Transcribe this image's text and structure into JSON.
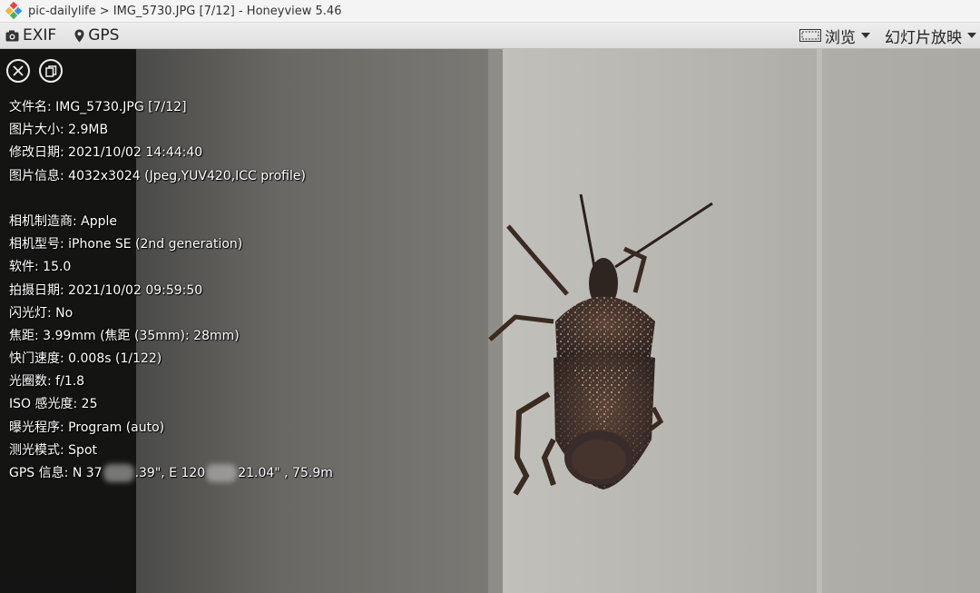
{
  "window": {
    "title": "pic-dailylife > IMG_5730.JPG [7/12] - Honeyview 5.46",
    "icon": "honeyview-logo-icon"
  },
  "toolbar": {
    "exif_label": "EXIF",
    "gps_label": "GPS",
    "browse_label": "浏览",
    "slideshow_label": "幻灯片放映"
  },
  "panel": {
    "close_icon": "close-icon",
    "copy_icon": "copy-icon",
    "file_info": [
      {
        "label": "文件名",
        "value": "IMG_5730.JPG [7/12]"
      },
      {
        "label": "图片大小",
        "value": "2.9MB"
      },
      {
        "label": "修改日期",
        "value": "2021/10/02 14:44:40"
      },
      {
        "label": "图片信息",
        "value": "4032x3024 (Jpeg,YUV420,ICC profile)"
      }
    ],
    "camera_info": [
      {
        "label": "相机制造商",
        "value": "Apple"
      },
      {
        "label": "相机型号",
        "value": "iPhone SE (2nd generation)"
      },
      {
        "label": "软件",
        "value": "15.0"
      },
      {
        "label": "拍摄日期",
        "value": "2021/10/02 09:59:50"
      },
      {
        "label": "闪光灯",
        "value": "No"
      },
      {
        "label": "焦距",
        "value": "3.99mm (焦距 (35mm): 28mm)"
      },
      {
        "label": "快门速度",
        "value": "0.008s (1/122)"
      },
      {
        "label": "光圈数",
        "value": "f/1.8"
      },
      {
        "label": "ISO 感光度",
        "value": "25"
      },
      {
        "label": "曝光程序",
        "value": "Program (auto)"
      },
      {
        "label": "测光模式",
        "value": "Spot"
      }
    ],
    "gps": {
      "label": "GPS 信息",
      "part1": "N 37",
      "part2": ".39\", E 120",
      "part3": "21.04\" , 75.9m"
    }
  },
  "colors": {
    "panel_bg": "#101010",
    "toolbar_bg": "#e6e6e6",
    "wall": "#b9b7b1",
    "bug": "#3a2c28"
  }
}
